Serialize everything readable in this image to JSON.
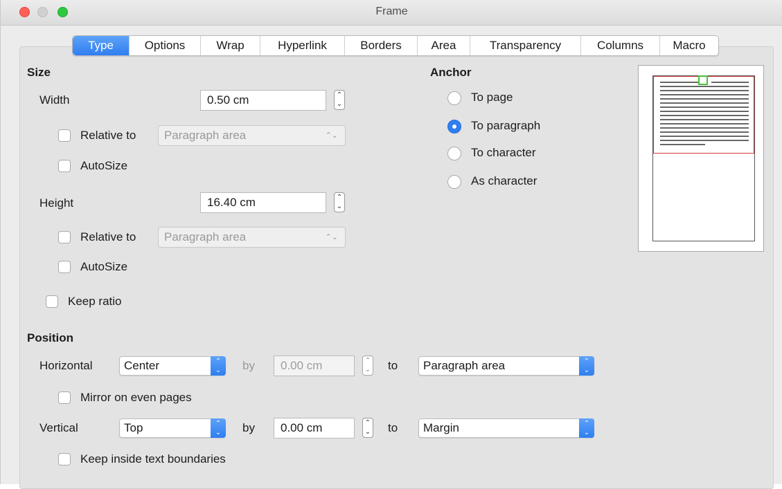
{
  "window": {
    "title": "Frame"
  },
  "tabs": [
    "Type",
    "Options",
    "Wrap",
    "Hyperlink",
    "Borders",
    "Area",
    "Transparency",
    "Columns",
    "Macro"
  ],
  "active_tab": "Type",
  "size": {
    "heading": "Size",
    "width": {
      "label": "Width",
      "value": "0.50 cm",
      "relative_label": "Relative to",
      "relative_value": "Paragraph area",
      "autosize_label": "AutoSize"
    },
    "height": {
      "label": "Height",
      "value": "16.40 cm",
      "relative_label": "Relative to",
      "relative_value": "Paragraph area",
      "autosize_label": "AutoSize"
    },
    "keep_ratio_label": "Keep ratio"
  },
  "anchor": {
    "heading": "Anchor",
    "options": [
      "To page",
      "To paragraph",
      "To character",
      "As character"
    ],
    "selected": "To paragraph"
  },
  "position": {
    "heading": "Position",
    "horizontal": {
      "label": "Horizontal",
      "value": "Center",
      "by_label": "by",
      "by_value": "0.00 cm",
      "to_label": "to",
      "to_value": "Paragraph area"
    },
    "mirror_label": "Mirror on even pages",
    "vertical": {
      "label": "Vertical",
      "value": "Top",
      "by_label": "by",
      "by_value": "0.00 cm",
      "to_label": "to",
      "to_value": "Margin"
    },
    "keep_inside_label": "Keep inside text boundaries"
  },
  "colors": {
    "accent": "#2f7ef1",
    "frame_outline": "#d23a3a",
    "handle": "#4cbf3c"
  }
}
